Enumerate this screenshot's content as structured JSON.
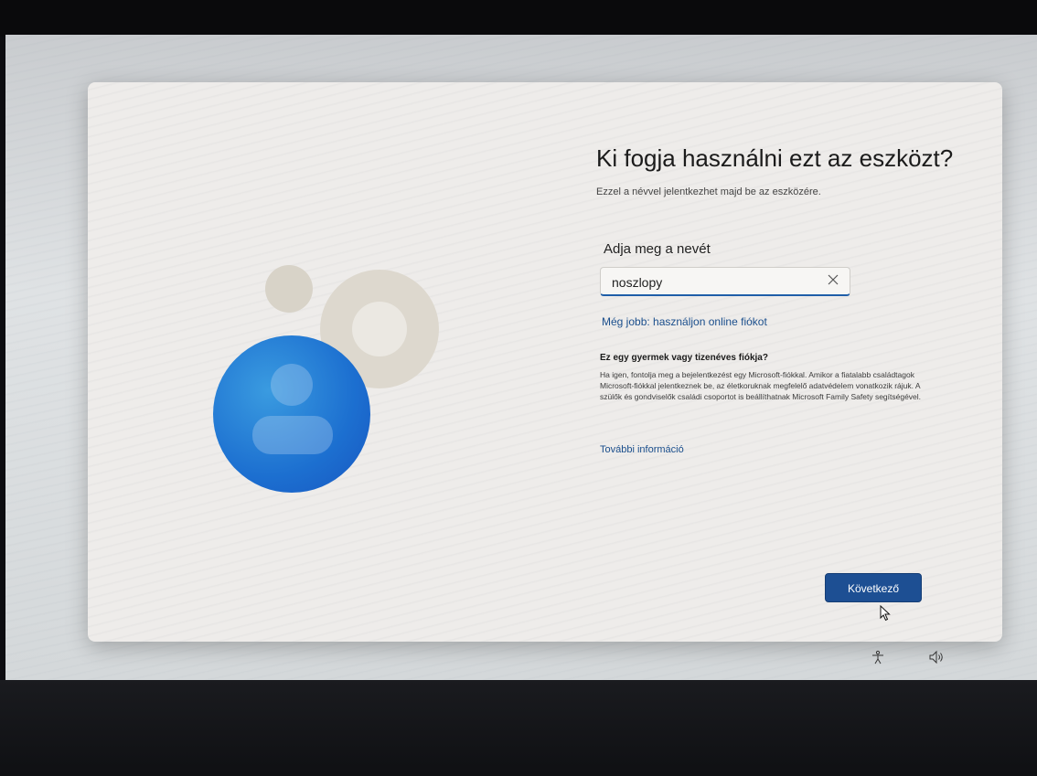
{
  "oobe": {
    "title": "Ki fogja használni ezt az eszközt?",
    "subtitle": "Ezzel a névvel jelentkezhet majd be az eszközére.",
    "name_label": "Adja meg a nevét",
    "name_value": "noszlopy",
    "online_account_link": "Még jobb: használjon online fiókot",
    "child_heading": "Ez egy gyermek vagy tizenéves fiókja?",
    "child_body": "Ha igen, fontolja meg a bejelentkezést egy Microsoft-fiókkal. Amikor a fiatalabb családtagok Microsoft-fiókkal jelentkeznek be, az életkoruknak megfelelő adatvédelem vonatkozik rájuk. A szülők és gondviselők családi csoportot is beállíthatnak Microsoft Family Safety segítségével.",
    "more_info_link": "További információ",
    "next_button": "Következő"
  },
  "icons": {
    "clear": "close-icon",
    "accessibility": "accessibility-icon",
    "volume": "volume-icon",
    "cursor": "mouse-cursor-icon"
  },
  "colors": {
    "accent": "#1d4f93",
    "link": "#1a4e8c",
    "illustration_blue": "#1c6fd0"
  }
}
